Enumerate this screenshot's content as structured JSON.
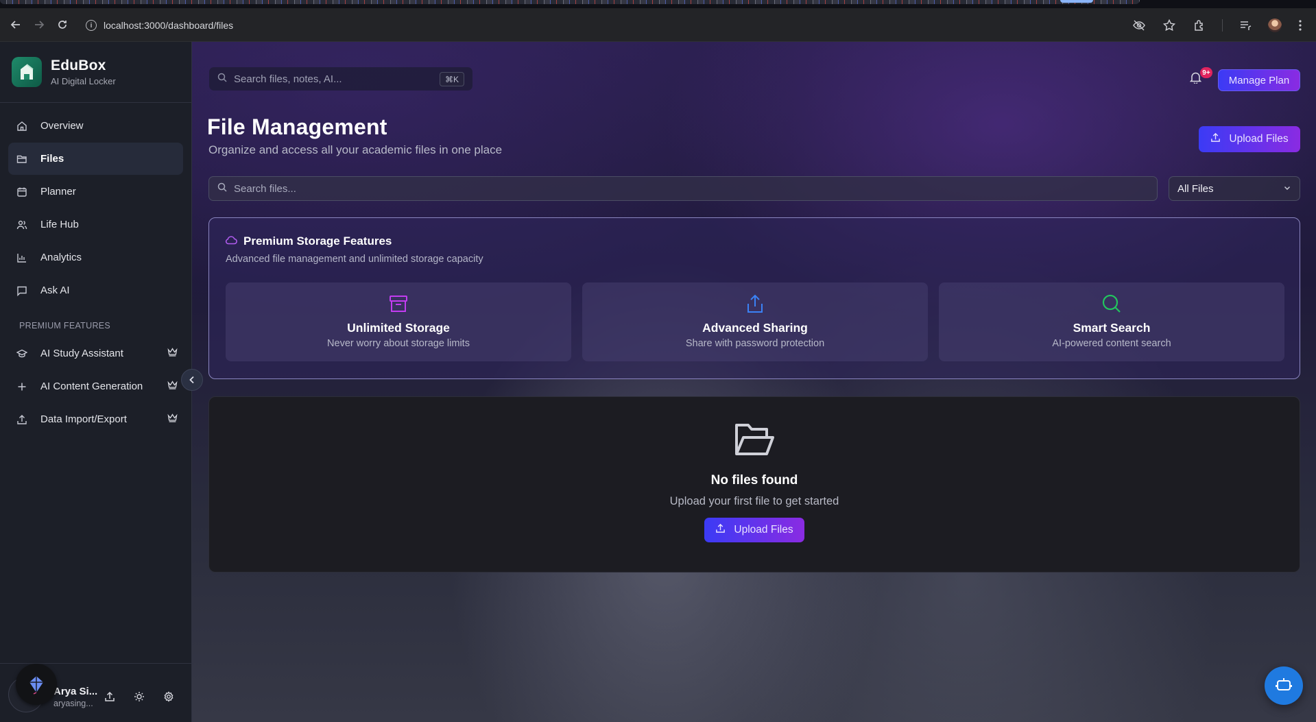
{
  "browser": {
    "url": "localhost:3000/dashboard/files"
  },
  "brand": {
    "name": "EduBox",
    "subtitle": "AI Digital Locker"
  },
  "sidebar": {
    "items": [
      {
        "label": "Overview",
        "icon": "home-icon"
      },
      {
        "label": "Files",
        "icon": "folder-icon",
        "active": true
      },
      {
        "label": "Planner",
        "icon": "calendar-icon"
      },
      {
        "label": "Life Hub",
        "icon": "users-icon"
      },
      {
        "label": "Analytics",
        "icon": "bar-chart-icon"
      },
      {
        "label": "Ask AI",
        "icon": "message-icon"
      }
    ],
    "premium_label": "PREMIUM FEATURES",
    "premium_items": [
      {
        "label": "AI Study Assistant",
        "icon": "graduation-cap-icon"
      },
      {
        "label": "AI Content Generation",
        "icon": "plus-icon"
      },
      {
        "label": "Data Import/Export",
        "icon": "upload-icon"
      }
    ],
    "user": {
      "name": "Arya Si...",
      "email": "aryasing..."
    }
  },
  "header": {
    "search_placeholder": "Search files, notes, AI...",
    "shortcut": "⌘K",
    "notification_badge": "9+",
    "manage_plan": "Manage Plan"
  },
  "page": {
    "title": "File Management",
    "subtitle": "Organize and access all your academic files in one place",
    "upload_button": "Upload Files",
    "search_placeholder": "Search files...",
    "filter_value": "All Files"
  },
  "premium": {
    "title": "Premium Storage Features",
    "subtitle": "Advanced file management and unlimited storage capacity",
    "features": [
      {
        "title": "Unlimited Storage",
        "desc": "Never worry about storage limits",
        "icon": "archive-icon",
        "color": "#c23cf0"
      },
      {
        "title": "Advanced Sharing",
        "desc": "Share with password protection",
        "icon": "share-upload-icon",
        "color": "#3b82f6"
      },
      {
        "title": "Smart Search",
        "desc": "AI-powered content search",
        "icon": "search-icon",
        "color": "#22c55e"
      }
    ]
  },
  "empty_state": {
    "title": "No files found",
    "subtitle": "Upload your first file to get started",
    "button": "Upload Files"
  },
  "colors": {
    "accent_start": "#3b3bf5",
    "accent_end": "#8a2be2",
    "chat_fab": "#1f7ae0"
  }
}
